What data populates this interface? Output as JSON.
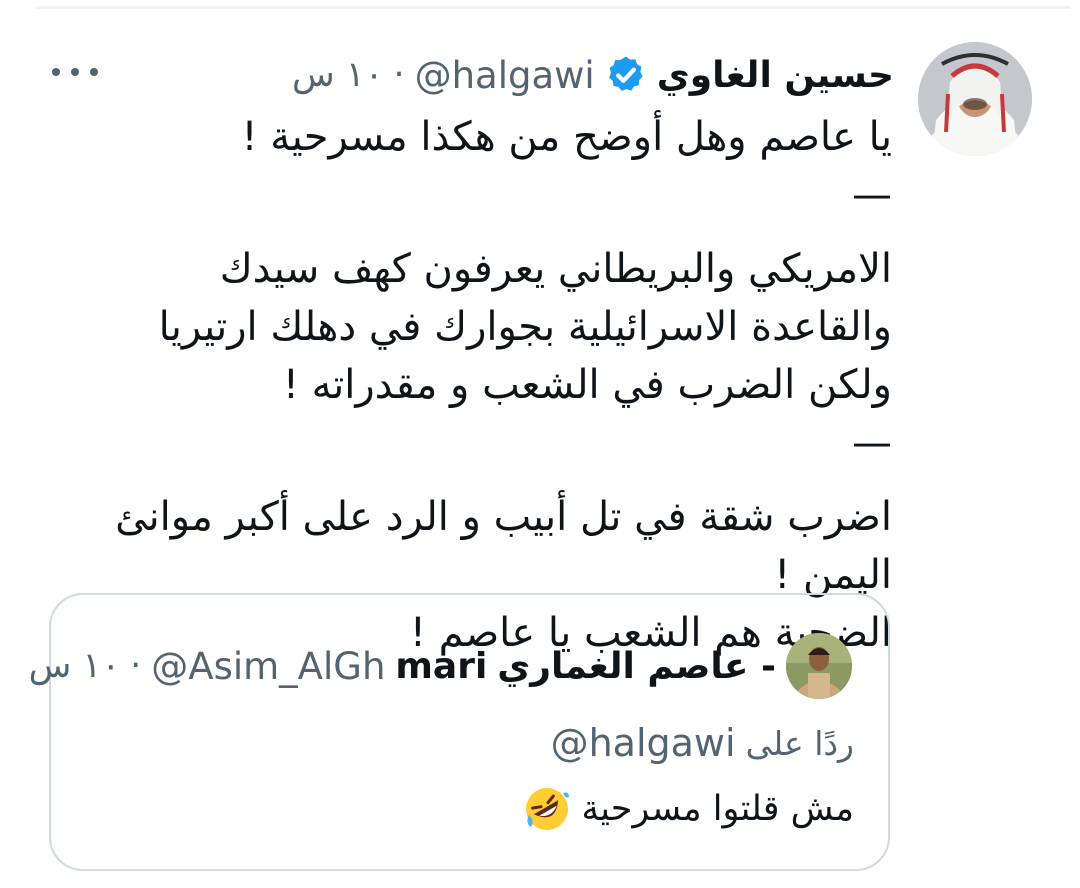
{
  "tweet": {
    "author_name": "حسين الغاوي",
    "verified": true,
    "handle": "@halgawi",
    "separator": "·",
    "time": "١٠ س",
    "paragraphs": [
      "يا عاصم وهل أوضح من هكذا مسرحية !\n—",
      "الامريكي والبريطاني يعرفون كهف سيدك والقاعدة الاسرائيلية بجوارك في دهلك ارتيريا ولكن الضرب في الشعب و مقدراته !\n—",
      "اضرب شقة في تل أبيب و الرد على أكبر موانئ اليمن !\nالضحية هم الشعب يا عاصم !"
    ],
    "more_icon": "more-horizontal-icon"
  },
  "quoted_tweet": {
    "author_name": "عاصم الغماري -",
    "author_name_suffix": "mari",
    "handle": "@Asim_AlGh",
    "separator": "·",
    "time": "١٠ س",
    "reply_label": "ردًا على",
    "reply_handle": "@halgawi",
    "text": "مش قلتوا مسرحية",
    "emoji": "rolling-on-floor-laughing-emoji"
  },
  "colors": {
    "text": "#0f1419",
    "secondary": "#536471",
    "verified": "#1d9bf0",
    "border": "#cfd9de"
  }
}
